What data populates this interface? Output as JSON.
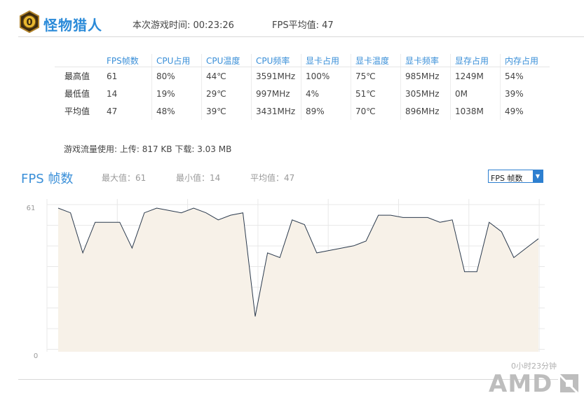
{
  "header": {
    "game_name": "怪物猎人",
    "session_time": "本次游戏时间: 00:23:26",
    "fps_avg": "FPS平均值: 47"
  },
  "stats": {
    "columns": [
      "FPS帧数",
      "CPU占用",
      "CPU温度",
      "CPU频率",
      "显卡占用",
      "显卡温度",
      "显卡频率",
      "显存占用",
      "内存占用"
    ],
    "rows": [
      {
        "label": "最高值",
        "values": [
          "61",
          "80%",
          "44℃",
          "3591MHz",
          "100%",
          "75℃",
          "985MHz",
          "1249M",
          "54%"
        ]
      },
      {
        "label": "最低值",
        "values": [
          "14",
          "19%",
          "29℃",
          "997MHz",
          "4%",
          "51℃",
          "305MHz",
          "0M",
          "39%"
        ]
      },
      {
        "label": "平均值",
        "values": [
          "47",
          "48%",
          "39℃",
          "3431MHz",
          "89%",
          "70℃",
          "896MHz",
          "1038M",
          "49%"
        ]
      }
    ]
  },
  "traffic": "游戏流量使用: 上传: 817 KB   下载: 3.03 MB",
  "chart_section": {
    "title": "FPS 帧数",
    "max": "最大值：61",
    "min": "最小值：14",
    "avg": "平均值：47",
    "selected_metric": "FPS 帧数",
    "elapsed": "0小时23分钟"
  },
  "chart_data": {
    "type": "area",
    "y_tick_top": "61",
    "y_tick_bottom": "0",
    "ylim": [
      0,
      61
    ],
    "values": [
      61,
      59,
      42,
      55,
      55,
      55,
      44,
      59,
      61,
      60,
      59,
      61,
      59,
      56,
      58,
      59,
      15,
      42,
      40,
      56,
      54,
      42,
      43,
      44,
      45,
      47,
      58,
      58,
      57,
      57,
      57,
      55,
      56,
      34,
      34,
      55,
      51,
      40,
      44,
      48
    ],
    "grid": true,
    "line_color": "#2b3a4d",
    "fill_color": "#f7f1e8"
  },
  "branding": {
    "logo_text": "AMD"
  }
}
